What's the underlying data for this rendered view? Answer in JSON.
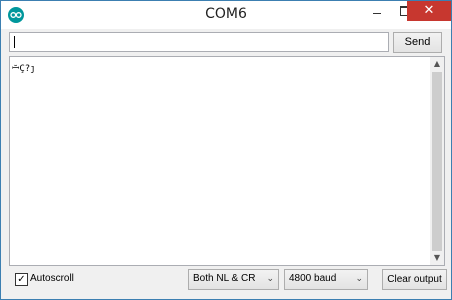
{
  "window": {
    "title": "COM6",
    "app_icon": "arduino-logo-icon",
    "controls": {
      "minimize": "minimize-icon",
      "maximize": "maximize-icon",
      "close": "close-icon"
    }
  },
  "toolbar": {
    "input_value": "",
    "send_label": "Send"
  },
  "output": {
    "text": "ꟷ̆Ç?ȷ"
  },
  "footer": {
    "autoscroll_label": "Autoscroll",
    "autoscroll_checked": true,
    "line_ending": "Both NL & CR",
    "baud_rate": "4800 baud",
    "clear_label": "Clear output"
  },
  "colors": {
    "close_button": "#c7372f",
    "app_icon": "#00979c",
    "border": "#3c7fb1"
  }
}
